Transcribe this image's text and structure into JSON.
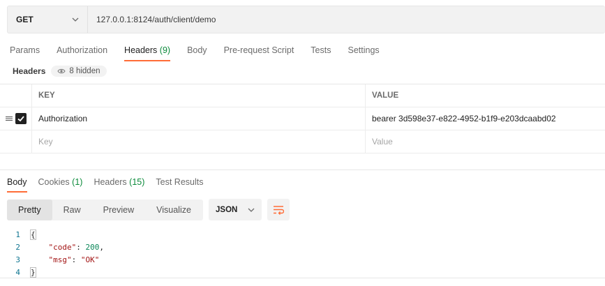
{
  "request": {
    "method": "GET",
    "url": "127.0.0.1:8124/auth/client/demo",
    "tabs": [
      {
        "label": "Params",
        "count": ""
      },
      {
        "label": "Authorization",
        "count": ""
      },
      {
        "label": "Headers",
        "count": "(9)"
      },
      {
        "label": "Body",
        "count": ""
      },
      {
        "label": "Pre-request Script",
        "count": ""
      },
      {
        "label": "Tests",
        "count": ""
      },
      {
        "label": "Settings",
        "count": ""
      }
    ],
    "active_tab": "Headers"
  },
  "headers_section": {
    "label": "Headers",
    "hidden_pill": "8 hidden",
    "columns": {
      "key": "KEY",
      "value": "VALUE"
    },
    "rows": [
      {
        "checked": true,
        "key": "Authorization",
        "value": "bearer 3d598e37-e822-4952-b1f9-e203dcaabd02"
      }
    ],
    "new_row": {
      "key_placeholder": "Key",
      "value_placeholder": "Value"
    }
  },
  "response": {
    "tabs": [
      {
        "label": "Body",
        "count": ""
      },
      {
        "label": "Cookies",
        "count": "(1)"
      },
      {
        "label": "Headers",
        "count": "(15)"
      },
      {
        "label": "Test Results",
        "count": ""
      }
    ],
    "active_tab": "Body",
    "view_modes": [
      "Pretty",
      "Raw",
      "Preview",
      "Visualize"
    ],
    "active_view": "Pretty",
    "format": "JSON",
    "body_lines": [
      {
        "num": "1",
        "text": "{"
      },
      {
        "num": "2",
        "key": "\"code\"",
        "value": "200",
        "suffix": ","
      },
      {
        "num": "3",
        "key": "\"msg\"",
        "value": "\"OK\"",
        "suffix": ""
      },
      {
        "num": "4",
        "text": "}"
      }
    ]
  },
  "colors": {
    "accent": "#ff6c37",
    "count_green": "#0b8a3a"
  }
}
